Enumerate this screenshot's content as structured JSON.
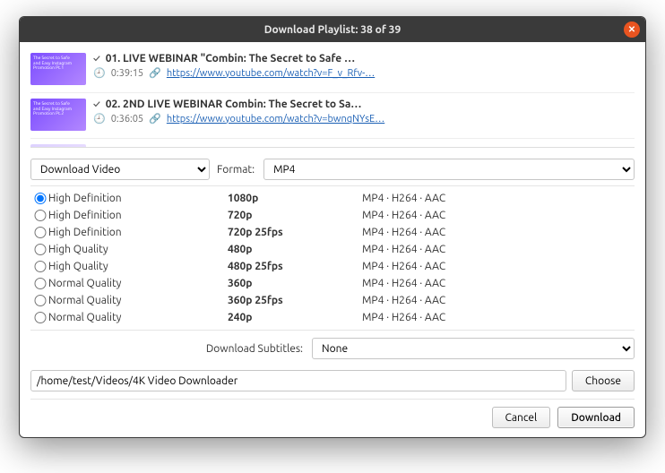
{
  "title": "Download Playlist: 38 of 39",
  "playlist": {
    "items": [
      {
        "checked": true,
        "title": "01. LIVE WEBINAR \"Combin: The Secret to Safe …",
        "duration": "0:39:15",
        "url": "https://www.youtube.com/watch?v=F_v_Rfv-…"
      },
      {
        "checked": true,
        "title": "02. 2ND LIVE WEBINAR Combin: The Secret to Sa…",
        "duration": "0:36:05",
        "url": "https://www.youtube.com/watch?v=bwnqNYsE…"
      }
    ]
  },
  "mode_select": {
    "value": "Download Video"
  },
  "format_label": "Format:",
  "format_select": {
    "value": "MP4"
  },
  "qualities": [
    {
      "selected": true,
      "name": "High Definition",
      "res": "1080p",
      "codec": "MP4 · H264 · AAC"
    },
    {
      "selected": false,
      "name": "High Definition",
      "res": "720p",
      "codec": "MP4 · H264 · AAC"
    },
    {
      "selected": false,
      "name": "High Definition",
      "res": "720p 25fps",
      "codec": "MP4 · H264 · AAC"
    },
    {
      "selected": false,
      "name": "High Quality",
      "res": "480p",
      "codec": "MP4 · H264 · AAC"
    },
    {
      "selected": false,
      "name": "High Quality",
      "res": "480p 25fps",
      "codec": "MP4 · H264 · AAC"
    },
    {
      "selected": false,
      "name": "Normal Quality",
      "res": "360p",
      "codec": "MP4 · H264 · AAC"
    },
    {
      "selected": false,
      "name": "Normal Quality",
      "res": "360p 25fps",
      "codec": "MP4 · H264 · AAC"
    },
    {
      "selected": false,
      "name": "Normal Quality",
      "res": "240p",
      "codec": "MP4 · H264 · AAC"
    }
  ],
  "subtitles": {
    "label": "Download Subtitles:",
    "value": "None"
  },
  "path": "/home/test/Videos/4K Video Downloader",
  "buttons": {
    "choose": "Choose",
    "cancel": "Cancel",
    "download": "Download"
  }
}
